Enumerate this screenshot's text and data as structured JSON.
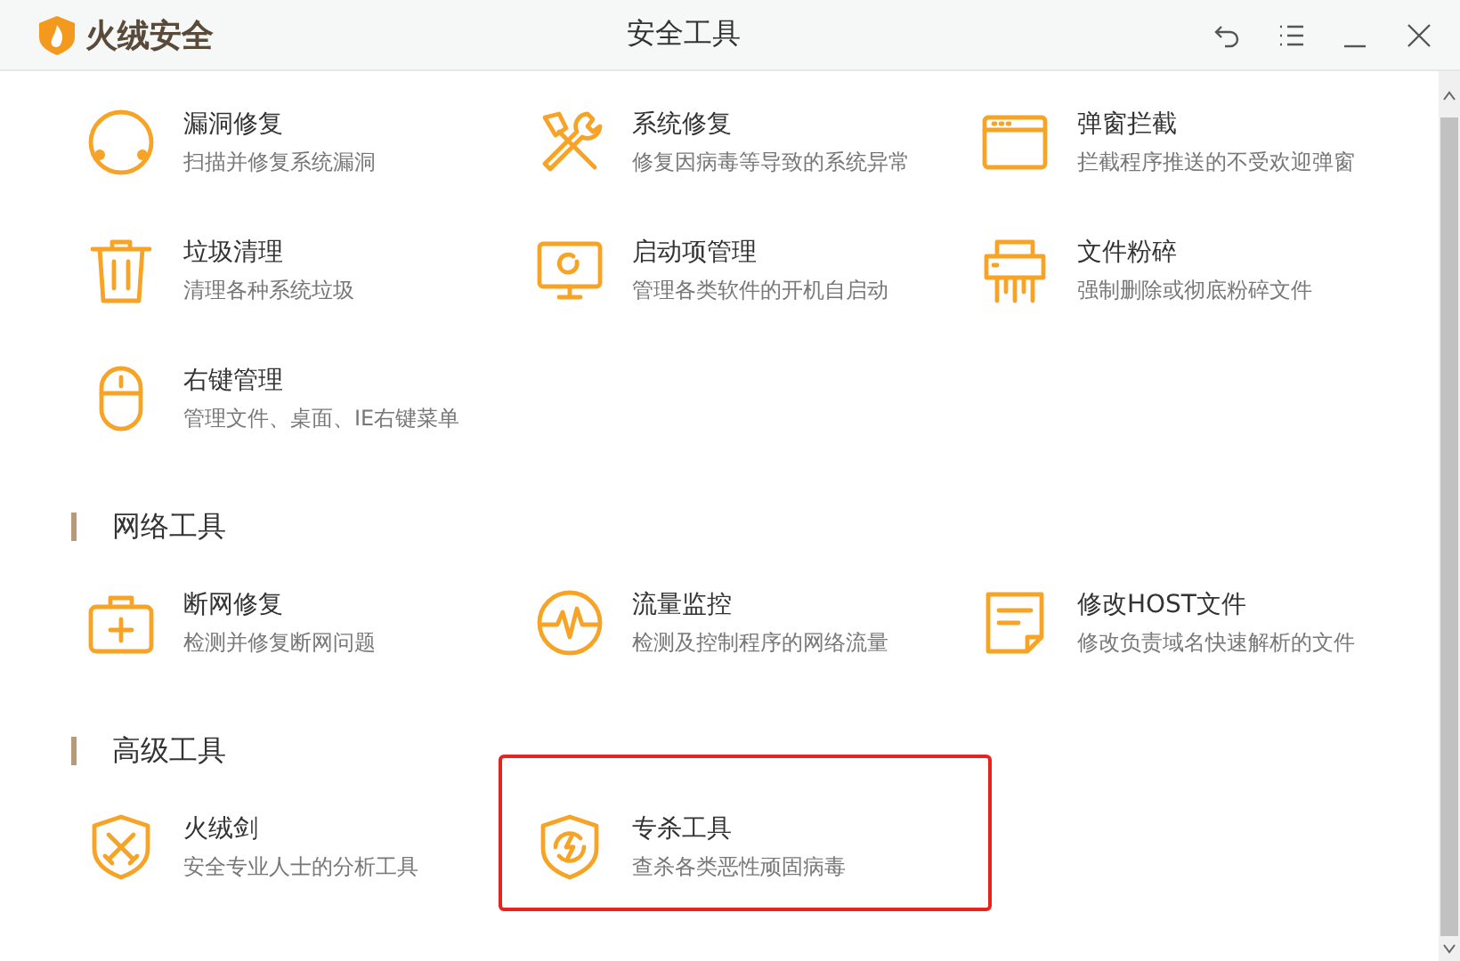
{
  "window": {
    "app_name": "火绒安全",
    "title": "安全工具"
  },
  "sections": [
    {
      "items": [
        {
          "name": "漏洞修复",
          "desc": "扫描并修复系统漏洞"
        },
        {
          "name": "系统修复",
          "desc": "修复因病毒等导致的系统异常"
        },
        {
          "name": "弹窗拦截",
          "desc": "拦截程序推送的不受欢迎弹窗"
        },
        {
          "name": "垃圾清理",
          "desc": "清理各种系统垃圾"
        },
        {
          "name": "启动项管理",
          "desc": "管理各类软件的开机自启动"
        },
        {
          "name": "文件粉碎",
          "desc": "强制删除或彻底粉碎文件"
        },
        {
          "name": "右键管理",
          "desc": "管理文件、桌面、IE右键菜单"
        }
      ]
    },
    {
      "title": "网络工具",
      "items": [
        {
          "name": "断网修复",
          "desc": "检测并修复断网问题"
        },
        {
          "name": "流量监控",
          "desc": "检测及控制程序的网络流量"
        },
        {
          "name": "修改HOST文件",
          "desc": "修改负责域名快速解析的文件"
        }
      ]
    },
    {
      "title": "高级工具",
      "items": [
        {
          "name": "火绒剑",
          "desc": "安全专业人士的分析工具",
          "highlighted": false
        },
        {
          "name": "专杀工具",
          "desc": "查杀各类恶性顽固病毒",
          "highlighted": true
        }
      ]
    }
  ]
}
